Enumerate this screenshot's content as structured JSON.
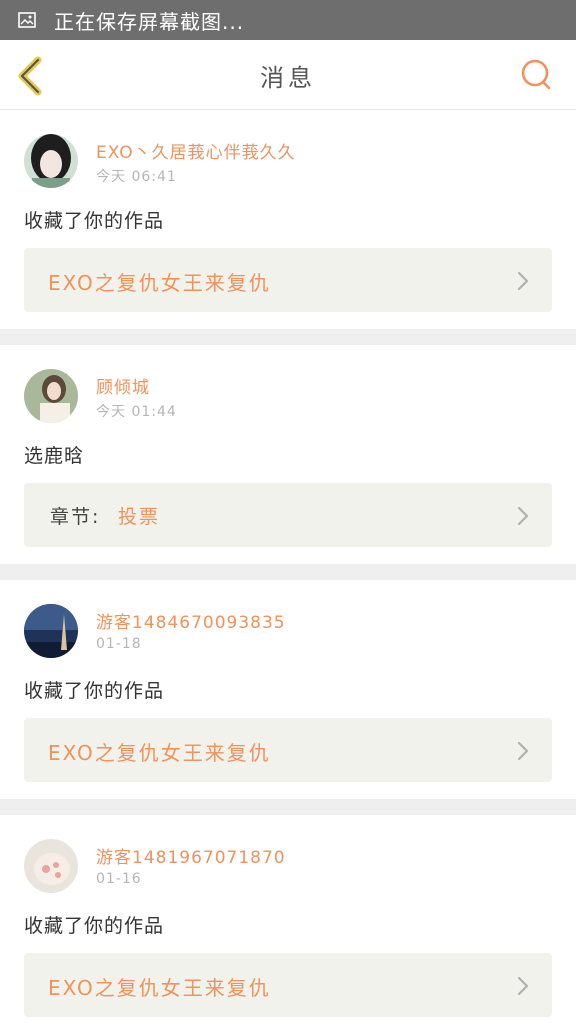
{
  "status_bar": {
    "icon": "image-icon",
    "text": "正在保存屏幕截图..."
  },
  "nav": {
    "back_icon": "chevron-left-icon",
    "title": "消息",
    "search_icon": "search-icon"
  },
  "colors": {
    "accent": "#f0925a",
    "status_bar": "#6e6e6e",
    "link_box": "#f2f2ec",
    "separator": "#efefef"
  },
  "messages": [
    {
      "username": "EXO丶久居莪心伴莪久久",
      "time": "今天 06:41",
      "action": "收藏了你的作品",
      "link": {
        "type": "work",
        "text": "EXO之复仇女王来复仇"
      }
    },
    {
      "username": "顾倾城",
      "time": "今天 01:44",
      "action": "选鹿晗",
      "link": {
        "type": "chapter",
        "label": "章节:",
        "text": "投票"
      }
    },
    {
      "username": "游客1484670093835",
      "time": "01-18",
      "action": "收藏了你的作品",
      "link": {
        "type": "work",
        "text": "EXO之复仇女王来复仇"
      }
    },
    {
      "username": "游客1481967071870",
      "time": "01-16",
      "action": "收藏了你的作品",
      "link": {
        "type": "work",
        "text": "EXO之复仇女王来复仇"
      }
    }
  ]
}
